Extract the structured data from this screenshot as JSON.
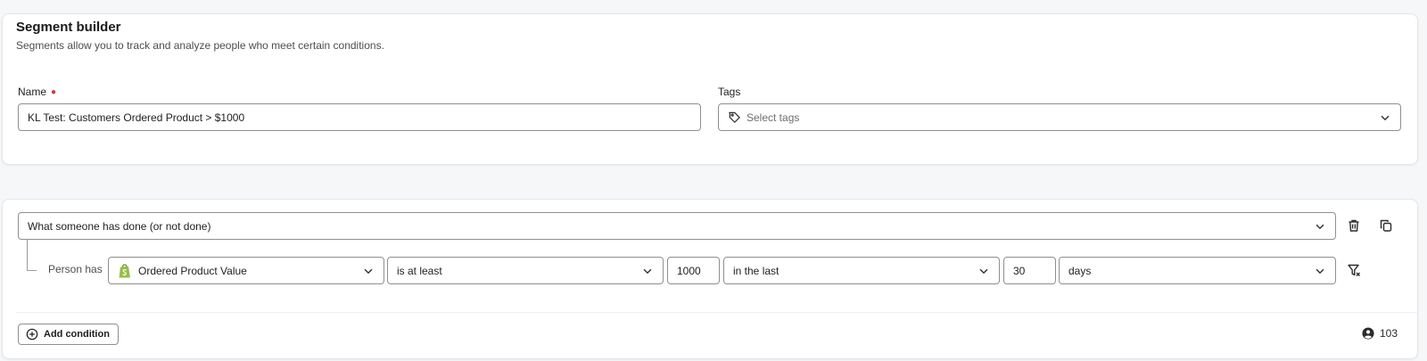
{
  "segment_builder": {
    "title": "Segment builder",
    "subtitle": "Segments allow you to track and analyze people who meet certain conditions.",
    "name_label": "Name",
    "name_value": "KL Test: Customers Ordered Product > $1000",
    "tags_label": "Tags",
    "tags_placeholder": "Select tags"
  },
  "condition_group": {
    "type_value": "What someone has done (or not done)",
    "row": {
      "prefix": "Person has",
      "metric": "Ordered Product Value",
      "operator": "is at least",
      "amount": "1000",
      "timeframe": "in the last",
      "quantity": "30",
      "unit": "days"
    },
    "add_condition_label": "Add condition",
    "profile_count": "103"
  },
  "icons": {
    "tag": "tag-icon",
    "chevron": "chevron-down-icon",
    "trash": "trash-icon",
    "copy": "copy-icon",
    "filter": "filter-icon",
    "shopify": "shopify-icon",
    "plus_circle": "plus-circle-icon",
    "person": "person-icon"
  },
  "colors": {
    "required": "#d2323a",
    "shopify_green": "#95bf47"
  }
}
